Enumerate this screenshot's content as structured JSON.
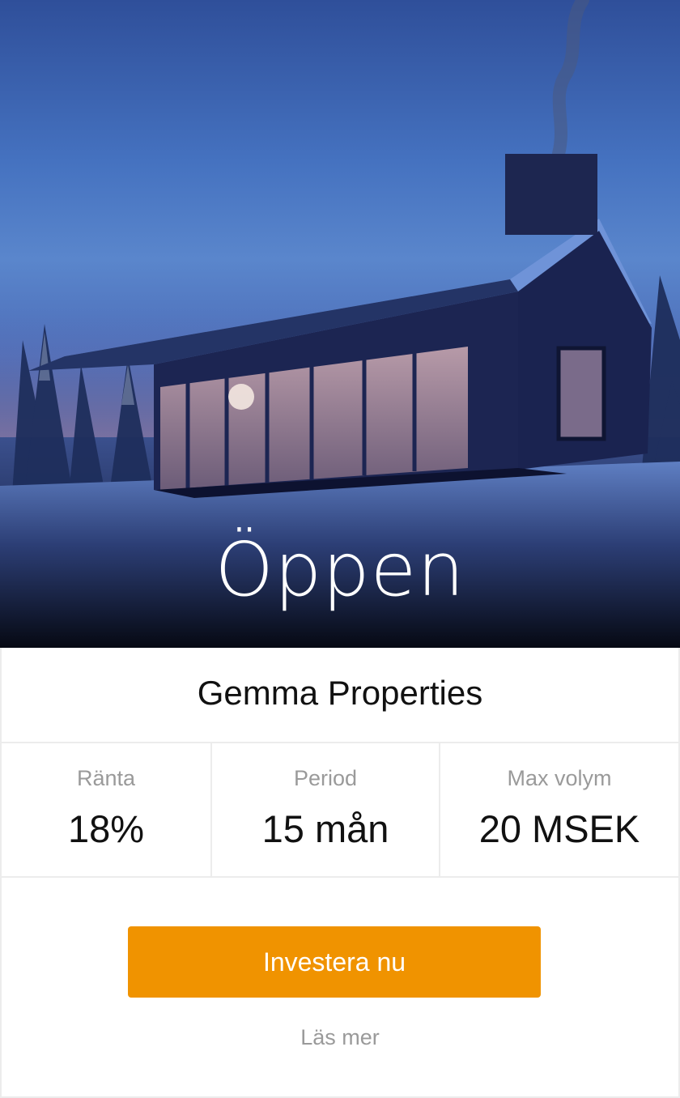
{
  "hero": {
    "status_label": "Öppen",
    "image_icon": "winter-cabin-image"
  },
  "company": {
    "name": "Gemma Properties"
  },
  "stats": [
    {
      "label": "Ränta",
      "value": "18%"
    },
    {
      "label": "Period",
      "value": "15 mån"
    },
    {
      "label": "Max volym",
      "value": "20 MSEK"
    }
  ],
  "actions": {
    "invest_label": "Investera nu",
    "read_more_label": "Läs mer"
  },
  "colors": {
    "accent": "#f09300",
    "muted_text": "#9a9a9a",
    "divider": "#ececec"
  }
}
